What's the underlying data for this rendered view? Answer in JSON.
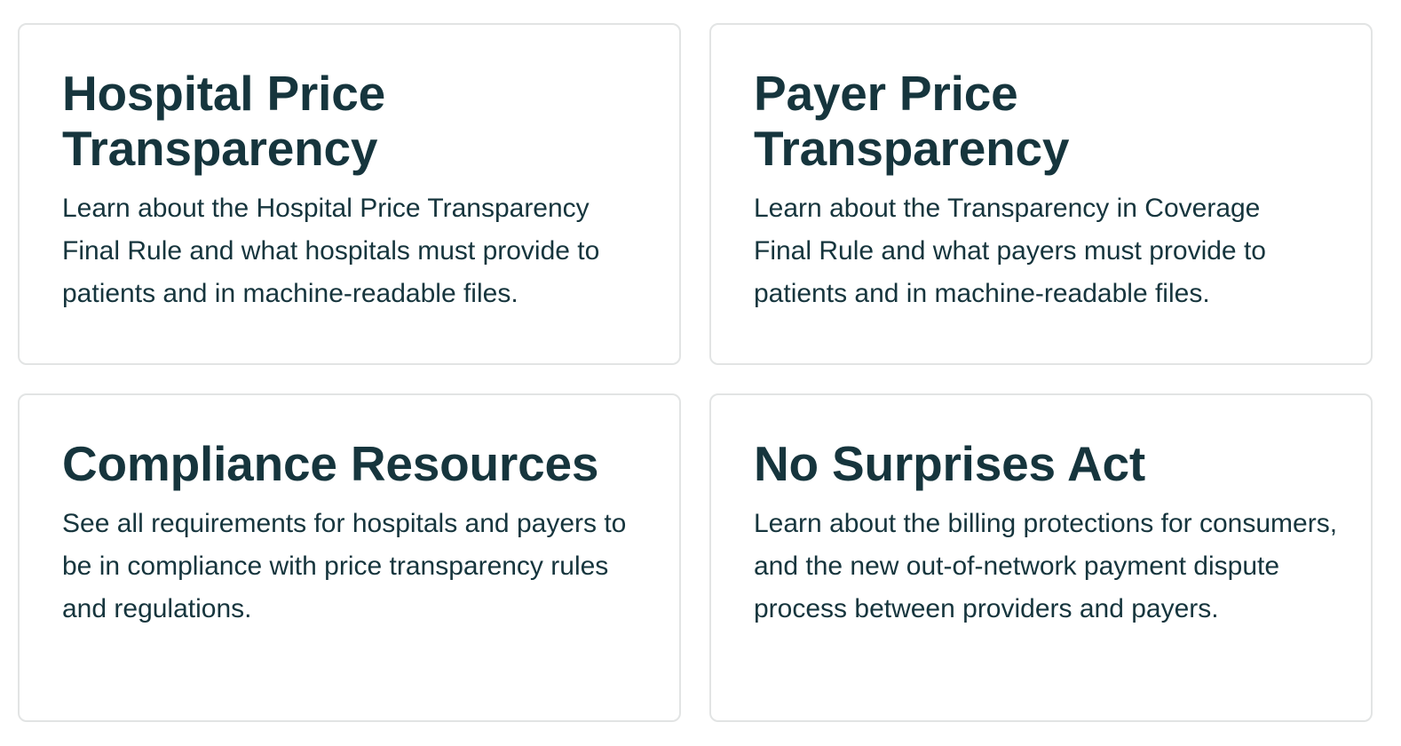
{
  "cards": [
    {
      "title": "Hospital Price Transparency",
      "description": "Learn about the Hospital Price Transparency Final Rule and what hospitals must provide to patients and in machine-readable files."
    },
    {
      "title": "Payer Price Transparency",
      "description": "Learn about the Transparency in Coverage Final Rule and what payers must provide to patients and in machine-readable files."
    },
    {
      "title": "Compliance Resources",
      "description": "See all requirements for hospitals and payers to be in compliance with price transparency rules and regulations."
    },
    {
      "title": "No Surprises Act",
      "description": "Learn about the billing protections for consumers, and the new out-of-network payment dispute process between providers and payers."
    }
  ],
  "colors": {
    "text": "#16353d",
    "border": "#e2e4e4",
    "background": "#ffffff"
  }
}
